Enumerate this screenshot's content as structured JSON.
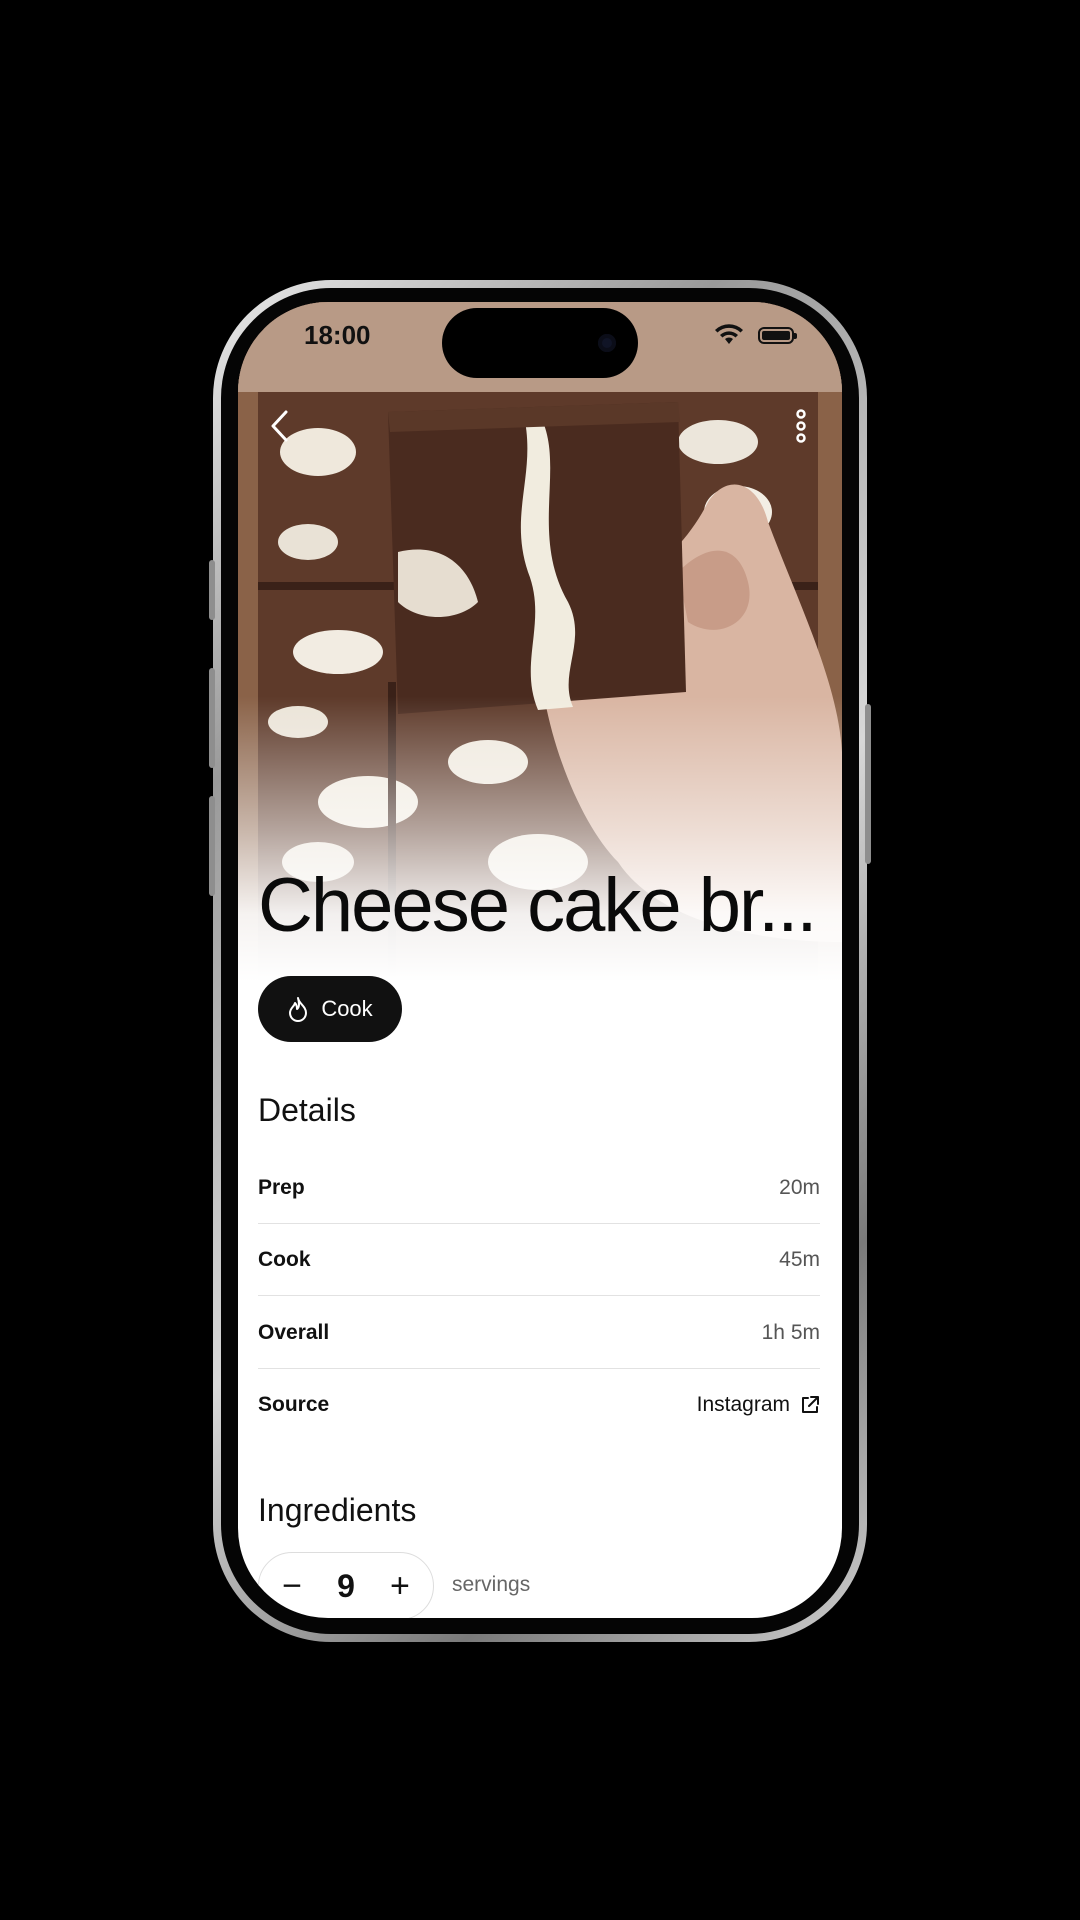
{
  "status_bar": {
    "time": "18:00"
  },
  "recipe": {
    "title": "Cheese cake br..."
  },
  "actions": {
    "cook_label": "Cook"
  },
  "details": {
    "heading": "Details",
    "rows": [
      {
        "label": "Prep",
        "value": "20m"
      },
      {
        "label": "Cook",
        "value": "45m"
      },
      {
        "label": "Overall",
        "value": "1h 5m"
      }
    ],
    "source": {
      "label": "Source",
      "value": "Instagram"
    }
  },
  "ingredients": {
    "heading": "Ingredients",
    "servings_count": "9",
    "servings_label": "servings",
    "decrement_symbol": "−",
    "increment_symbol": "+"
  },
  "icons": {
    "back": "chevron-left-icon",
    "more": "more-vertical-icon",
    "flame": "flame-icon",
    "external_link": "external-link-icon",
    "wifi": "wifi-icon",
    "battery": "battery-icon"
  },
  "colors": {
    "accent": "#111111",
    "page_background": "#000000",
    "divider": "#e2e2e2"
  }
}
